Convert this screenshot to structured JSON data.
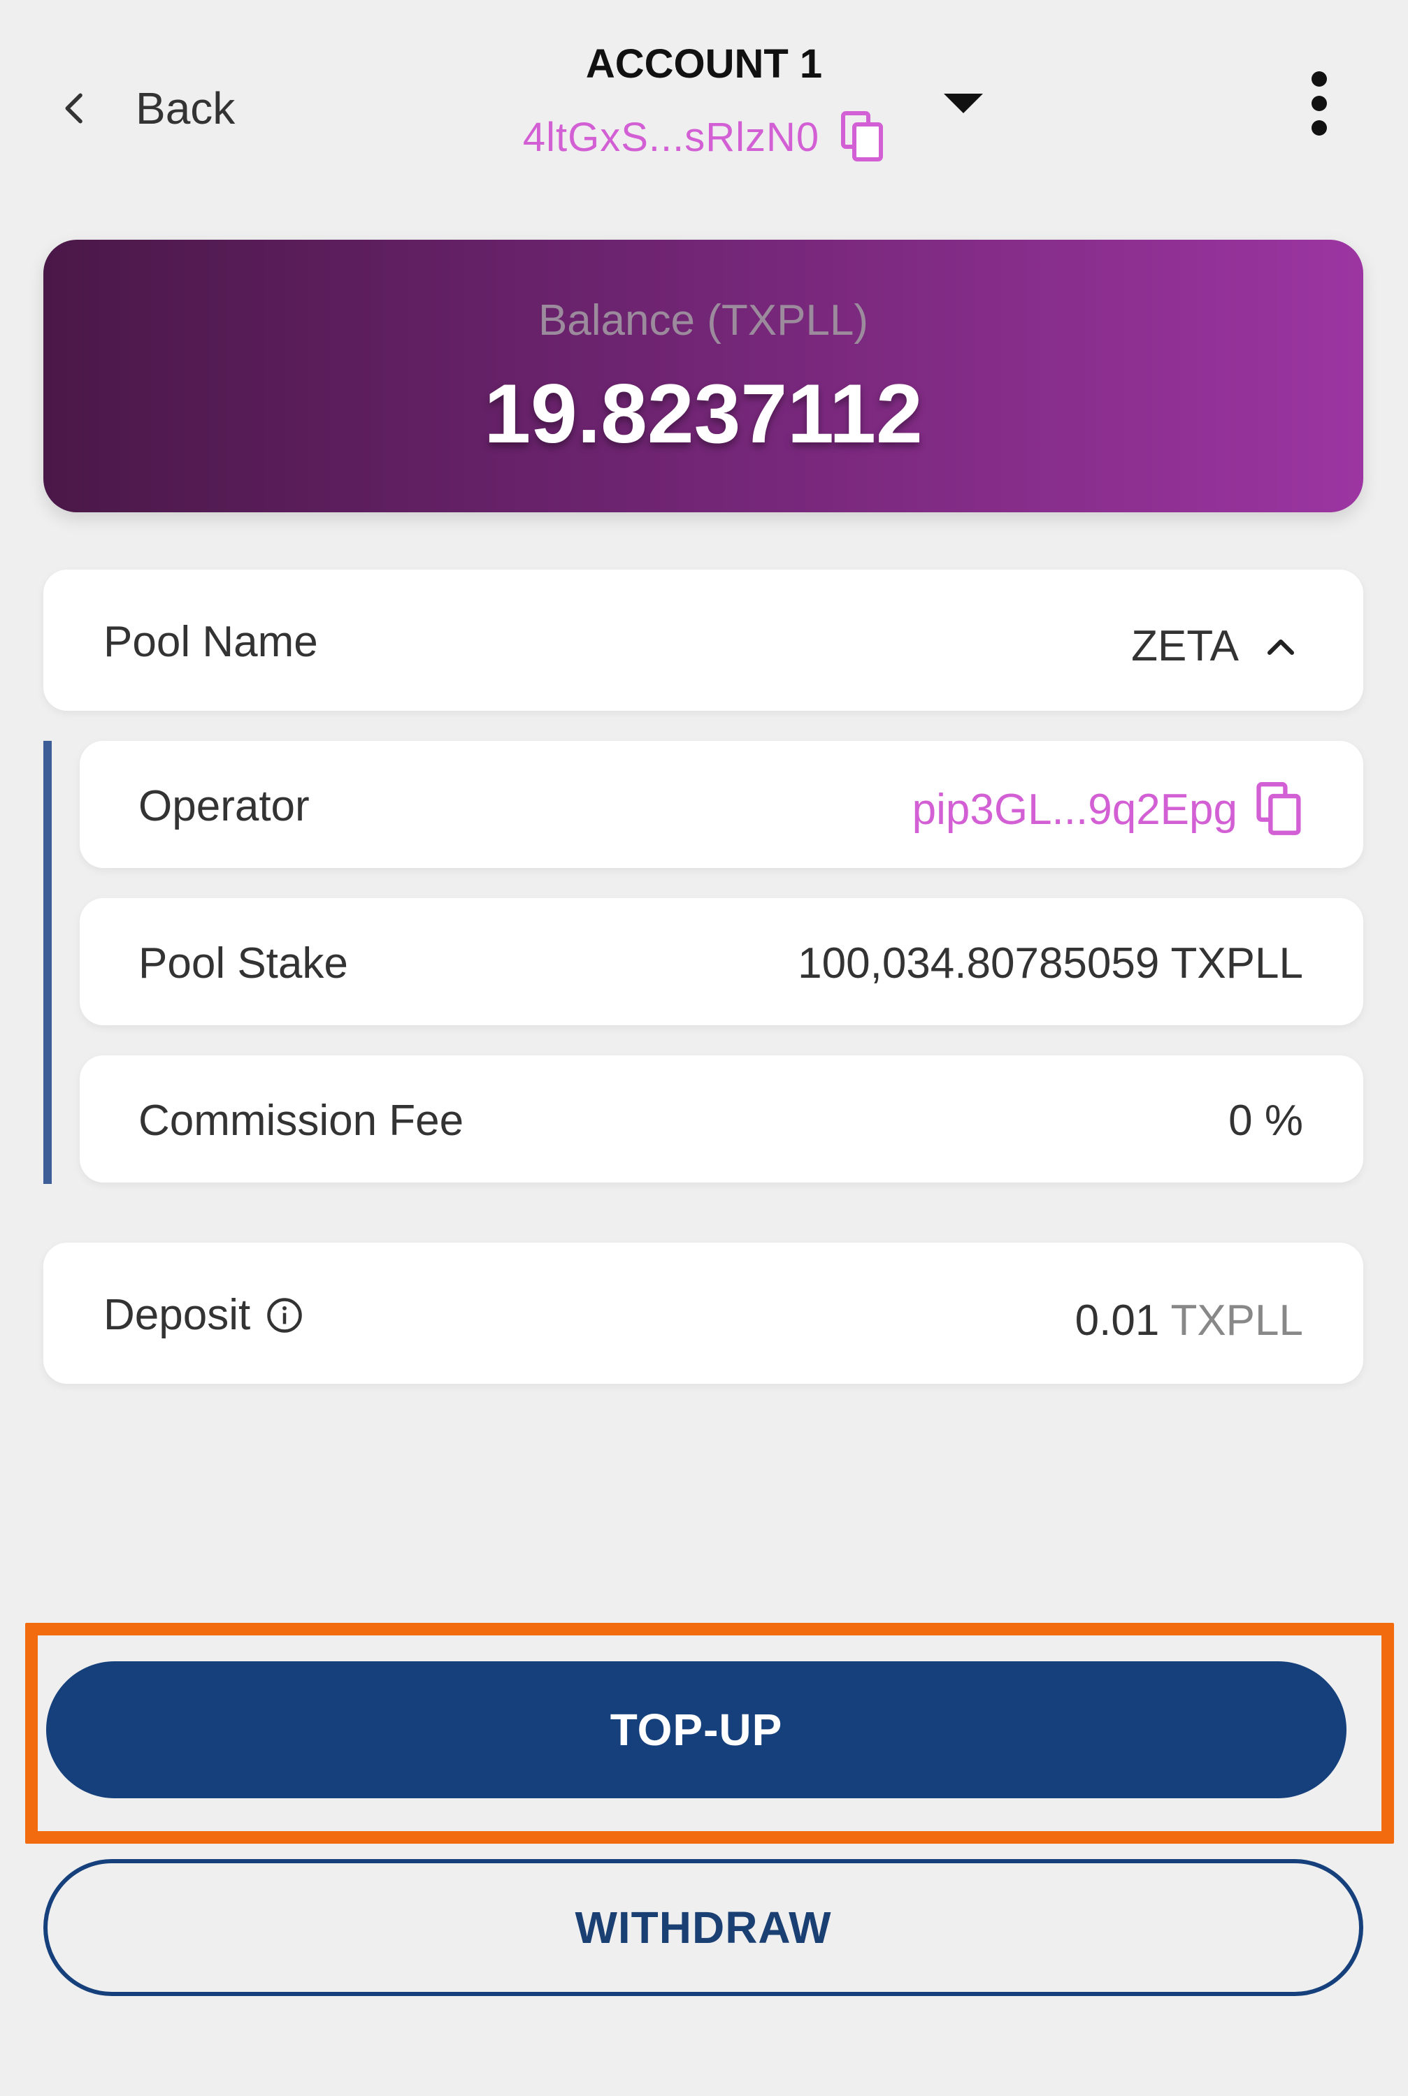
{
  "header": {
    "back_label": "Back",
    "account_title": "ACCOUNT 1",
    "account_address": "4ltGxS...sRlzN0"
  },
  "balance": {
    "label": "Balance (TXPLL)",
    "value": "19.8237112"
  },
  "pool": {
    "label": "Pool Name",
    "value": "ZETA",
    "operator_label": "Operator",
    "operator_value": "pip3GL...9q2Epg",
    "stake_label": "Pool Stake",
    "stake_value": "100,034.80785059 TXPLL",
    "fee_label": "Commission Fee",
    "fee_value": "0 %"
  },
  "deposit": {
    "label": "Deposit",
    "amount": "0.01",
    "unit": "TXPLL"
  },
  "buttons": {
    "topup_label": "TOP-UP",
    "withdraw_label": "WITHDRAW"
  },
  "colors": {
    "accent_pink": "#d35fd4",
    "primary_blue": "#15407c",
    "highlight_orange": "#f26b0f",
    "balance_gradient_start": "#4a1848",
    "balance_gradient_end": "#9c35a1"
  },
  "icons": [
    "chevron-left-icon",
    "copy-icon",
    "caret-down-icon",
    "more-vertical-icon",
    "chevron-up-icon",
    "info-icon"
  ]
}
